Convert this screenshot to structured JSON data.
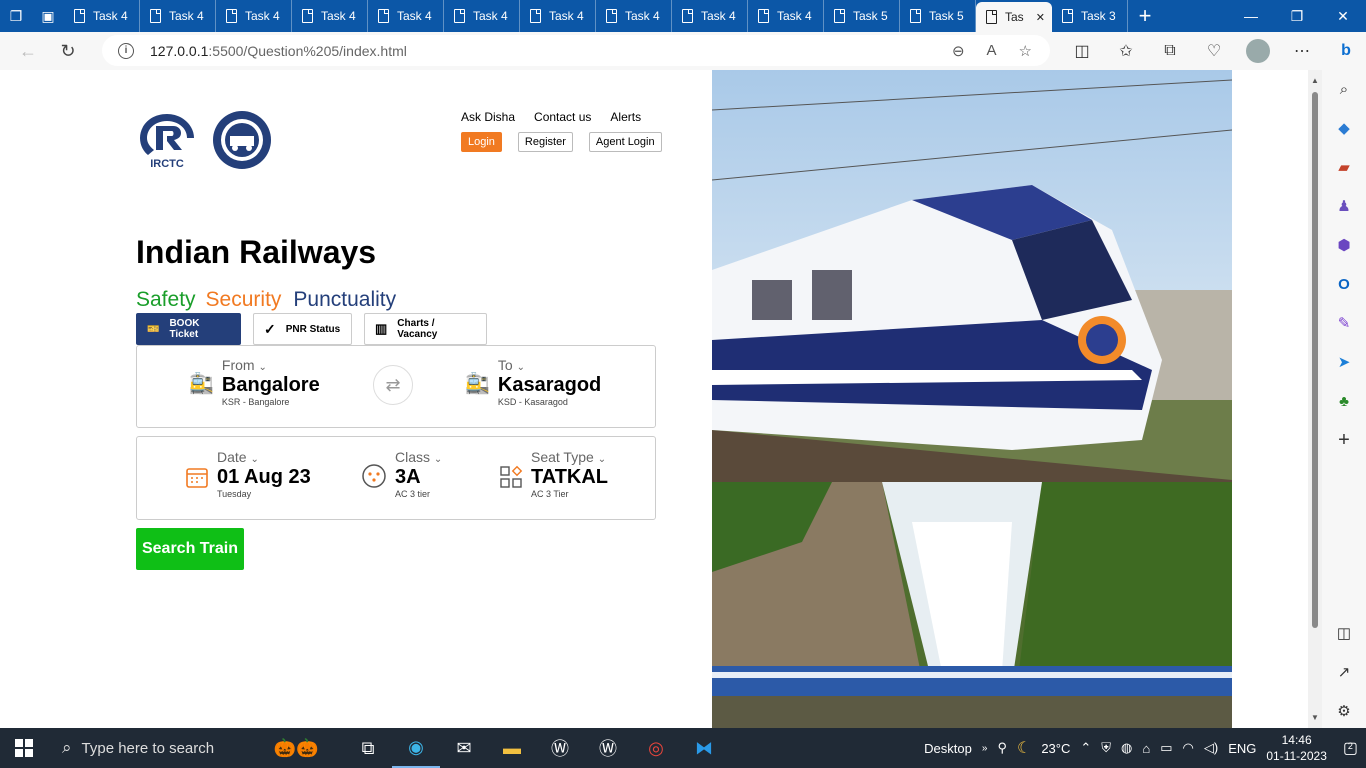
{
  "browser": {
    "tabs": [
      {
        "label": "Task 4",
        "active": false
      },
      {
        "label": "Task 4",
        "active": false
      },
      {
        "label": "Task 4",
        "active": false
      },
      {
        "label": "Task 4",
        "active": false
      },
      {
        "label": "Task 4",
        "active": false
      },
      {
        "label": "Task 4",
        "active": false
      },
      {
        "label": "Task 4",
        "active": false
      },
      {
        "label": "Task 4",
        "active": false
      },
      {
        "label": "Task 4",
        "active": false
      },
      {
        "label": "Task 4",
        "active": false
      },
      {
        "label": "Task 5",
        "active": false
      },
      {
        "label": "Task 5",
        "active": false
      },
      {
        "label": "Tas",
        "active": true
      },
      {
        "label": "Task 3",
        "active": false
      }
    ],
    "url_host": "127.0.0.1",
    "url_path": ":5500/Question%205/index.html"
  },
  "site": {
    "logo1_text": "IRCTC",
    "top_links": [
      "Ask Disha",
      "Contact us",
      "Alerts"
    ],
    "login": "Login",
    "register": "Register",
    "agent_login": "Agent Login",
    "heading": "Indian Railways",
    "tagline": {
      "safety": "Safety",
      "security": "Security",
      "punctuality": "Punctuality",
      "colors": {
        "safety": "#1a9e2a",
        "security": "#f17a22",
        "punctuality": "#243f7a"
      }
    },
    "tabs": [
      "BOOK Ticket",
      "PNR Status",
      "Charts / Vacancy"
    ],
    "from": {
      "label": "From",
      "value": "Bangalore",
      "code": "KSR - Bangalore"
    },
    "to": {
      "label": "To",
      "value": "Kasaragod",
      "code": "KSD - Kasaragod"
    },
    "date": {
      "label": "Date",
      "value": "01 Aug 23",
      "sub": "Tuesday"
    },
    "class": {
      "label": "Class",
      "value": "3A",
      "sub": "AC 3 tier"
    },
    "seat": {
      "label": "Seat Type",
      "value": "TATKAL",
      "sub": "AC 3 Tier"
    },
    "search_button": "Search Train"
  },
  "taskbar": {
    "search_placeholder": "Type here to search",
    "desktop_label": "Desktop",
    "temperature": "23°C",
    "language": "ENG",
    "time": "14:46",
    "date": "01-11-2023",
    "notification_count": "2"
  }
}
